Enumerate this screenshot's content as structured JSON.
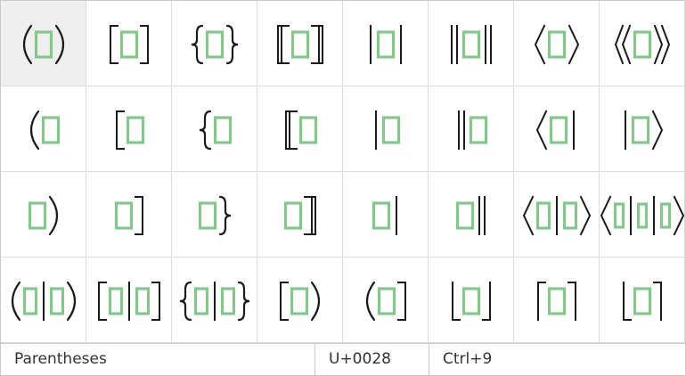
{
  "grid": {
    "columns": 8,
    "rows": 4,
    "selected_index": 0,
    "cells": [
      {
        "name": "parentheses",
        "left": "paren-left",
        "right": "paren-right",
        "mid": []
      },
      {
        "name": "square-brackets",
        "left": "bracket-left",
        "right": "bracket-right",
        "mid": []
      },
      {
        "name": "curly-braces",
        "left": "brace-left",
        "right": "brace-right",
        "mid": []
      },
      {
        "name": "double-square-brackets",
        "left": "dbracket-left",
        "right": "dbracket-right",
        "mid": []
      },
      {
        "name": "vertical-bars",
        "left": "bar",
        "right": "bar",
        "mid": []
      },
      {
        "name": "double-vertical-bars",
        "left": "dbar",
        "right": "dbar",
        "mid": []
      },
      {
        "name": "angle-brackets",
        "left": "angle-left",
        "right": "angle-right",
        "mid": []
      },
      {
        "name": "double-angle-brackets",
        "left": "dangle-left",
        "right": "dangle-right",
        "mid": []
      },
      {
        "name": "left-parenthesis",
        "left": "paren-left",
        "right": null,
        "mid": []
      },
      {
        "name": "left-square-bracket",
        "left": "bracket-left",
        "right": null,
        "mid": []
      },
      {
        "name": "left-curly-brace",
        "left": "brace-left",
        "right": null,
        "mid": []
      },
      {
        "name": "left-double-square-bracket",
        "left": "dbracket-left",
        "right": null,
        "mid": []
      },
      {
        "name": "left-vertical-bar",
        "left": "bar",
        "right": null,
        "mid": []
      },
      {
        "name": "left-double-vertical-bar",
        "left": "dbar",
        "right": null,
        "mid": []
      },
      {
        "name": "bra",
        "left": "angle-left",
        "right": "bar",
        "mid": []
      },
      {
        "name": "ket",
        "left": "bar",
        "right": "angle-right",
        "mid": []
      },
      {
        "name": "right-parenthesis",
        "left": null,
        "right": "paren-right",
        "mid": []
      },
      {
        "name": "right-square-bracket",
        "left": null,
        "right": "bracket-right",
        "mid": []
      },
      {
        "name": "right-curly-brace",
        "left": null,
        "right": "brace-right",
        "mid": []
      },
      {
        "name": "right-double-square-bracket",
        "left": null,
        "right": "dbracket-right",
        "mid": []
      },
      {
        "name": "right-vertical-bar",
        "left": null,
        "right": "bar",
        "mid": []
      },
      {
        "name": "right-double-vertical-bar",
        "left": null,
        "right": "dbar",
        "mid": []
      },
      {
        "name": "bra-ket",
        "left": "angle-left",
        "right": "angle-right",
        "mid": [
          "bar"
        ]
      },
      {
        "name": "bra-operator-ket",
        "left": "angle-left",
        "right": "angle-right",
        "mid": [
          "bar",
          "bar"
        ]
      },
      {
        "name": "parentheses-with-separator",
        "left": "paren-left",
        "right": "paren-right",
        "mid": [
          "bar"
        ]
      },
      {
        "name": "square-brackets-with-separator",
        "left": "bracket-left",
        "right": "bracket-right",
        "mid": [
          "bar"
        ]
      },
      {
        "name": "curly-braces-with-separator",
        "left": "brace-left",
        "right": "brace-right",
        "mid": [
          "bar"
        ]
      },
      {
        "name": "bracket-parenthesis",
        "left": "bracket-left",
        "right": "paren-right",
        "mid": []
      },
      {
        "name": "parenthesis-bracket",
        "left": "paren-left",
        "right": "bracket-right",
        "mid": []
      },
      {
        "name": "floor",
        "left": "floor-left",
        "right": "floor-right",
        "mid": []
      },
      {
        "name": "ceiling",
        "left": "ceil-left",
        "right": "ceil-right",
        "mid": []
      },
      {
        "name": "floor-ceiling",
        "left": "floor-left",
        "right": "ceil-right",
        "mid": []
      }
    ]
  },
  "status": {
    "name": "Parentheses",
    "code": "U+0028",
    "shortcut": "Ctrl+9"
  }
}
